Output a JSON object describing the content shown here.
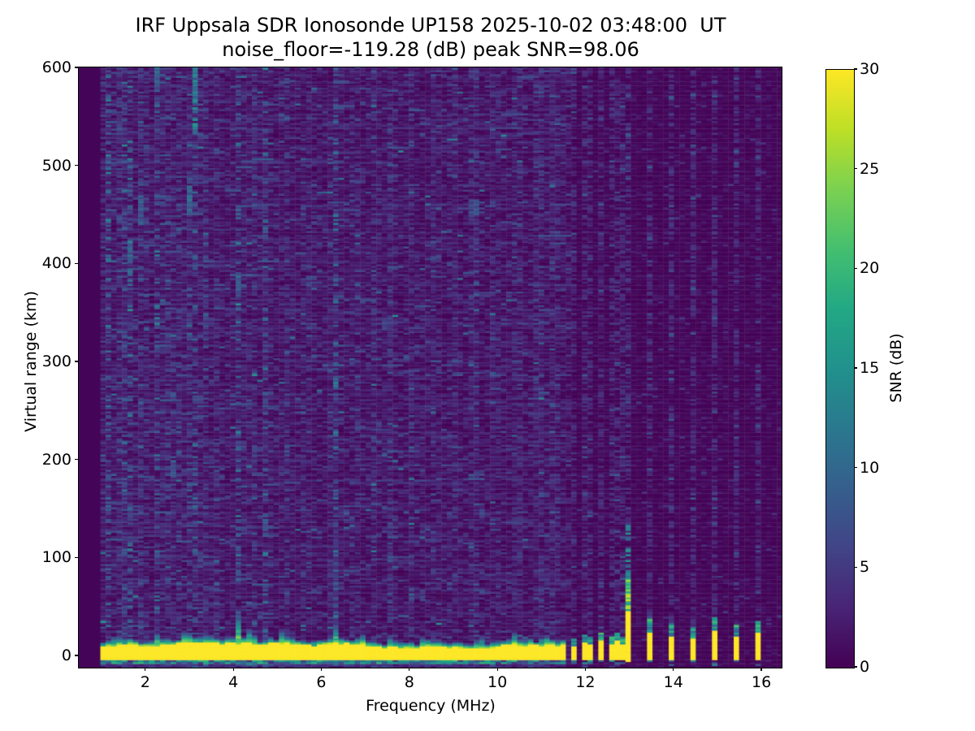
{
  "figure": {
    "background": "#ffffff",
    "text_color": "#000000"
  },
  "chart_data": {
    "type": "heatmap",
    "title": "IRF Uppsala SDR Ionosonde UP158 2025-10-02 03:48:00  UT",
    "subtitle": "noise_floor=-119.28 (dB) peak SNR=98.06",
    "xlabel": "Frequency (MHz)",
    "ylabel": "Virtual range (km)",
    "x_ticks": [
      2,
      4,
      6,
      8,
      10,
      12,
      14,
      16
    ],
    "y_ticks": [
      0,
      100,
      200,
      300,
      400,
      500,
      600
    ],
    "xlim": [
      0.49,
      16.46
    ],
    "ylim": [
      -12.4,
      600
    ],
    "noise_floor_db": -119.28,
    "peak_snr_db": 98.06,
    "colorbar": {
      "label": "SNR (dB)",
      "min": 0,
      "max": 30,
      "ticks": [
        0,
        5,
        10,
        15,
        20,
        25,
        30
      ],
      "colormap": "viridis",
      "stops": [
        [
          0,
          "#440154"
        ],
        [
          0.1,
          "#482475"
        ],
        [
          0.2,
          "#414487"
        ],
        [
          0.3,
          "#355f8d"
        ],
        [
          0.4,
          "#2a788e"
        ],
        [
          0.5,
          "#21918c"
        ],
        [
          0.6,
          "#22a884"
        ],
        [
          0.7,
          "#44bf70"
        ],
        [
          0.8,
          "#7ad151"
        ],
        [
          0.9,
          "#bddf26"
        ],
        [
          1,
          "#fde725"
        ]
      ]
    },
    "data_extent": {
      "mesh_f_start": 0.49,
      "noise_f_start": 0.98,
      "mesh_f_end": 16.38,
      "sweep_noise_end": 11.62
    },
    "ground_echo": {
      "f_start": 1.0,
      "f_end": 11.56,
      "band_km": [
        -5,
        10
      ],
      "snr": 30
    },
    "rfi_bars": {
      "narrow_freqs": [
        11.74,
        11.95,
        12.15,
        12.37,
        12.55,
        12.72,
        12.88
      ],
      "narrow_yellow_tops_km": [
        9,
        13,
        10,
        14,
        10,
        15,
        11
      ],
      "tall": {
        "f": 12.98,
        "yellow_top_km": 45,
        "green_top_km": 78,
        "teal_top_km": 135
      },
      "isolated": [
        [
          13.48,
          22,
          36
        ],
        [
          13.99,
          19,
          32
        ],
        [
          14.49,
          16,
          28
        ],
        [
          14.95,
          24,
          38
        ],
        [
          15.47,
          18,
          30
        ],
        [
          15.97,
          22,
          34
        ]
      ]
    },
    "noise_lanes": [
      [
        1.15,
        0.12,
        2.2
      ],
      [
        1.45,
        0.05,
        1.5
      ],
      [
        1.62,
        0.05,
        2.0
      ],
      [
        1.95,
        0.06,
        1.8
      ],
      [
        2.3,
        0.06,
        2.1
      ],
      [
        2.55,
        0.05,
        1.5
      ],
      [
        2.8,
        0.04,
        1.3
      ],
      [
        3.08,
        0.05,
        2.5
      ],
      [
        3.35,
        0.05,
        1.4
      ],
      [
        3.62,
        0.04,
        1.1
      ],
      [
        4.12,
        0.06,
        2.0
      ],
      [
        4.45,
        0.05,
        1.4
      ],
      [
        4.75,
        0.05,
        1.7
      ],
      [
        5.2,
        0.05,
        1.3
      ],
      [
        5.65,
        0.04,
        1.0
      ],
      [
        6.3,
        0.05,
        2.3
      ],
      [
        6.78,
        0.04,
        1.0
      ],
      [
        7.2,
        0.04,
        1.1
      ],
      [
        7.55,
        0.04,
        1.2
      ],
      [
        8.05,
        0.04,
        1.0
      ],
      [
        8.55,
        0.04,
        1.0
      ],
      [
        9.0,
        0.04,
        1.1
      ],
      [
        9.47,
        0.04,
        1.4
      ],
      [
        9.95,
        0.04,
        1.0
      ],
      [
        10.45,
        0.04,
        1.1
      ],
      [
        10.95,
        0.05,
        1.5
      ],
      [
        11.3,
        0.05,
        1.3
      ]
    ],
    "speckle_clusters": [
      [
        3.08,
        530,
        600,
        14
      ],
      [
        3.06,
        448,
        478,
        12
      ],
      [
        1.62,
        378,
        425,
        10
      ],
      [
        1.95,
        438,
        468,
        9
      ],
      [
        2.62,
        180,
        205,
        10
      ],
      [
        4.15,
        365,
        390,
        9
      ],
      [
        4.75,
        120,
        145,
        10
      ],
      [
        9.47,
        448,
        465,
        8
      ],
      [
        6.55,
        138,
        152,
        9
      ],
      [
        2.3,
        575,
        600,
        9
      ],
      [
        6.3,
        15,
        170,
        5
      ],
      [
        4.12,
        12,
        45,
        8
      ],
      [
        9.62,
        140,
        155,
        7
      ],
      [
        7.5,
        330,
        345,
        6
      ],
      [
        5.5,
        248,
        262,
        7
      ],
      [
        2.05,
        505,
        520,
        7
      ],
      [
        1.4,
        530,
        545,
        6
      ],
      [
        3.3,
        88,
        102,
        7
      ],
      [
        4.45,
        200,
        215,
        6
      ],
      [
        8.3,
        55,
        68,
        6
      ],
      [
        10.3,
        390,
        400,
        5
      ],
      [
        5.9,
        438,
        448,
        6
      ]
    ],
    "fringe_plumes": [
      [
        4.12,
        28
      ],
      [
        4.4,
        15
      ],
      [
        6.3,
        20
      ],
      [
        2.95,
        12
      ],
      [
        5.15,
        12
      ],
      [
        7.6,
        10
      ],
      [
        8.35,
        9
      ],
      [
        9.62,
        12
      ],
      [
        10.4,
        10
      ],
      [
        3.45,
        10
      ],
      [
        1.35,
        9
      ],
      [
        11.1,
        8
      ],
      [
        2.3,
        8
      ],
      [
        6.9,
        8
      ]
    ],
    "render": {
      "seed": 20251002,
      "df": 0.123,
      "dkm": 2.0
    }
  }
}
